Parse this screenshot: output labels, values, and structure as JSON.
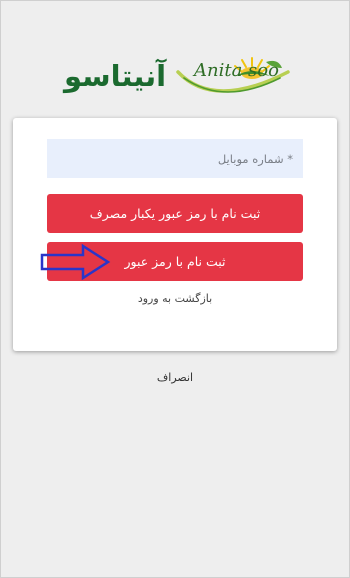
{
  "header": {
    "brand_fa": "آنیتاسو",
    "brand_latin": "Anita soo"
  },
  "form": {
    "mobile_placeholder": "* شماره موبایل",
    "otp_button_label": "ثبت نام با رمز عبور یکبار مصرف",
    "password_button_label": "ثبت نام با رمز عبور",
    "back_to_login_label": "بازگشت به ورود"
  },
  "footer": {
    "cancel_label": "انصراف"
  },
  "colors": {
    "button": "#e53645",
    "input_bg": "#e8effc",
    "brand_green": "#1b6a2f",
    "annotation_arrow": "#2a35c9"
  },
  "icons": {
    "logo": "anita-soo-logo-mark",
    "annotation": "arrow-right-outline-icon"
  }
}
